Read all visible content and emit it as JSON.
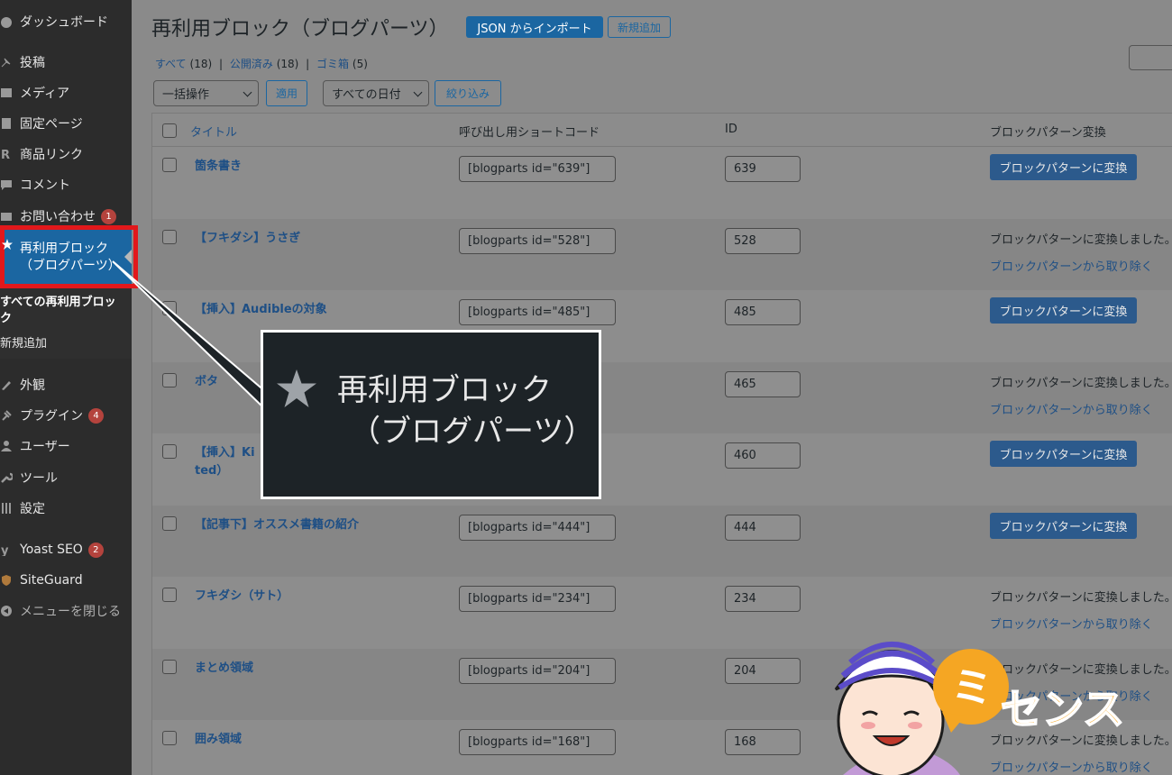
{
  "sidebar": {
    "items": [
      {
        "label": "ダッシュボード",
        "icon": "dashboard-icon"
      },
      {
        "label": "投稿",
        "icon": "pin-icon"
      },
      {
        "label": "メディア",
        "icon": "media-icon"
      },
      {
        "label": "固定ページ",
        "icon": "page-icon"
      },
      {
        "label": "商品リンク",
        "icon": "r-icon"
      },
      {
        "label": "コメント",
        "icon": "comment-icon"
      },
      {
        "label": "お問い合わせ",
        "icon": "mail-icon",
        "badge": "1"
      },
      {
        "label": "外観",
        "icon": "brush-icon"
      },
      {
        "label": "プラグイン",
        "icon": "plugin-icon",
        "badge": "4"
      },
      {
        "label": "ユーザー",
        "icon": "user-icon"
      },
      {
        "label": "ツール",
        "icon": "wrench-icon"
      },
      {
        "label": "設定",
        "icon": "settings-icon"
      },
      {
        "label": "Yoast SEO",
        "icon": "yoast-icon",
        "badge": "2"
      },
      {
        "label": "SiteGuard",
        "icon": "shield-icon"
      },
      {
        "label": "メニューを閉じる",
        "icon": "collapse-icon"
      }
    ],
    "current": {
      "line1": "再利用ブロック",
      "line2": "（ブログパーツ）",
      "icon": "star-icon"
    },
    "submenu": [
      "すべての再利用ブロッ",
      "ク",
      "新規追加"
    ]
  },
  "header": {
    "title": "再利用ブロック（ブログパーツ）",
    "import_label": "JSON からインポート",
    "add_new_label": "新規追加"
  },
  "filters": {
    "all": "すべて",
    "all_count": "(18)",
    "published": "公開済み",
    "published_count": "(18)",
    "trash": "ゴミ箱",
    "trash_count": "(5)",
    "sep": "|"
  },
  "toolbar": {
    "bulk_action": "一括操作",
    "apply": "適用",
    "dates": "すべての日付",
    "filter": "絞り込み"
  },
  "table": {
    "columns": [
      "タイトル",
      "呼び出し用ショートコード",
      "ID",
      "ブロックパターン変換"
    ],
    "convert_label": "ブロックパターンに変換",
    "converted_label": "ブロックパターンに変換しました。",
    "remove_label": "ブロックパターンから取り除く",
    "rows": [
      {
        "title": "箇条書き",
        "title2": "",
        "shortcode": "[blogparts id=\"639\"]",
        "id": "639",
        "converted": false
      },
      {
        "title": "【フキダシ】うさぎ",
        "title2": "",
        "shortcode": "[blogparts id=\"528\"]",
        "id": "528",
        "converted": true
      },
      {
        "title": "【挿入】Audibleの対象",
        "title2": "",
        "shortcode": "[blogparts id=\"485\"]",
        "id": "485",
        "converted": false
      },
      {
        "title": "ボタ",
        "title2": "",
        "shortcode": "",
        "id": "465",
        "converted": true
      },
      {
        "title": "【挿入】Ki",
        "title2": "ted）",
        "shortcode": "",
        "id": "460",
        "converted": false
      },
      {
        "title": "【記事下】オススメ書籍の紹介",
        "title2": "",
        "shortcode": "[blogparts id=\"444\"]",
        "id": "444",
        "converted": false
      },
      {
        "title": "フキダシ（サト）",
        "title2": "",
        "shortcode": "[blogparts id=\"234\"]",
        "id": "234",
        "converted": true
      },
      {
        "title": "まとめ領域",
        "title2": "",
        "shortcode": "[blogparts id=\"204\"]",
        "id": "204",
        "converted": true
      },
      {
        "title": "囲み領域",
        "title2": "",
        "shortcode": "[blogparts id=\"168\"]",
        "id": "168",
        "converted": true
      }
    ]
  },
  "callout": {
    "line1": "再利用ブロック",
    "line2": "（ブログパーツ）",
    "icon": "star-icon"
  },
  "logo": {
    "text": "センス",
    "mark": "ミ",
    "colors": {
      "orange": "#f5a623",
      "face_skin": "#fce4d4"
    }
  },
  "colors": {
    "wp_blue": "#1b66a1",
    "highlight_red": "#e2181b",
    "sidebar_bg": "#2c2c2c"
  }
}
